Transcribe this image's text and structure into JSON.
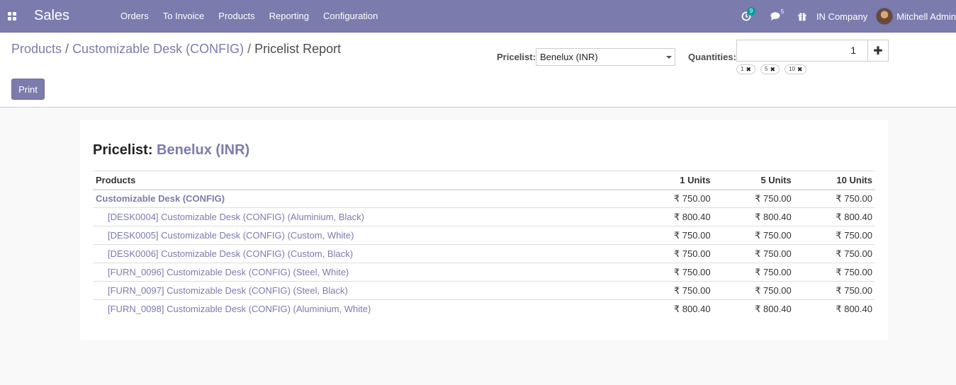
{
  "navbar": {
    "brand": "Sales",
    "menu": [
      "Orders",
      "To Invoice",
      "Products",
      "Reporting",
      "Configuration"
    ],
    "activity_count": "9",
    "messages_count": "5",
    "company": "IN Company",
    "user": "Mitchell Admin",
    "icons": [
      "apps-icon",
      "clock-icon",
      "chat-icon",
      "gift-icon"
    ],
    "colors": {
      "primary": "#7c7bad",
      "badge": "#00a09d"
    }
  },
  "breadcrumb": {
    "items": [
      "Products",
      "Customizable Desk (CONFIG)",
      "Pricelist Report"
    ],
    "separator": "/"
  },
  "actions": {
    "print_label": "Print"
  },
  "filters": {
    "pricelist_label": "Pricelist:",
    "pricelist_value": "Benelux (INR)",
    "quantities_label": "Quantities:",
    "quantity_input": "1",
    "quantity_tags": [
      "1",
      "5",
      "10"
    ]
  },
  "report": {
    "title_prefix": "Pricelist:",
    "title_pricelist": "Benelux (INR)",
    "columns": [
      "Products",
      "1 Units",
      "5 Units",
      "10 Units"
    ],
    "rows": [
      {
        "name": "Customizable Desk (CONFIG)",
        "prices": [
          "₹ 750.00",
          "₹ 750.00",
          "₹ 750.00"
        ]
      },
      {
        "name": "[DESK0004] Customizable Desk (CONFIG) (Aluminium, Black)",
        "prices": [
          "₹ 800.40",
          "₹ 800.40",
          "₹ 800.40"
        ]
      },
      {
        "name": "[DESK0005] Customizable Desk (CONFIG) (Custom, White)",
        "prices": [
          "₹ 750.00",
          "₹ 750.00",
          "₹ 750.00"
        ]
      },
      {
        "name": "[DESK0006] Customizable Desk (CONFIG) (Custom, Black)",
        "prices": [
          "₹ 750.00",
          "₹ 750.00",
          "₹ 750.00"
        ]
      },
      {
        "name": "[FURN_0096] Customizable Desk (CONFIG) (Steel, White)",
        "prices": [
          "₹ 750.00",
          "₹ 750.00",
          "₹ 750.00"
        ]
      },
      {
        "name": "[FURN_0097] Customizable Desk (CONFIG) (Steel, Black)",
        "prices": [
          "₹ 750.00",
          "₹ 750.00",
          "₹ 750.00"
        ]
      },
      {
        "name": "[FURN_0098] Customizable Desk (CONFIG) (Aluminium, White)",
        "prices": [
          "₹ 800.40",
          "₹ 800.40",
          "₹ 800.40"
        ]
      }
    ]
  }
}
